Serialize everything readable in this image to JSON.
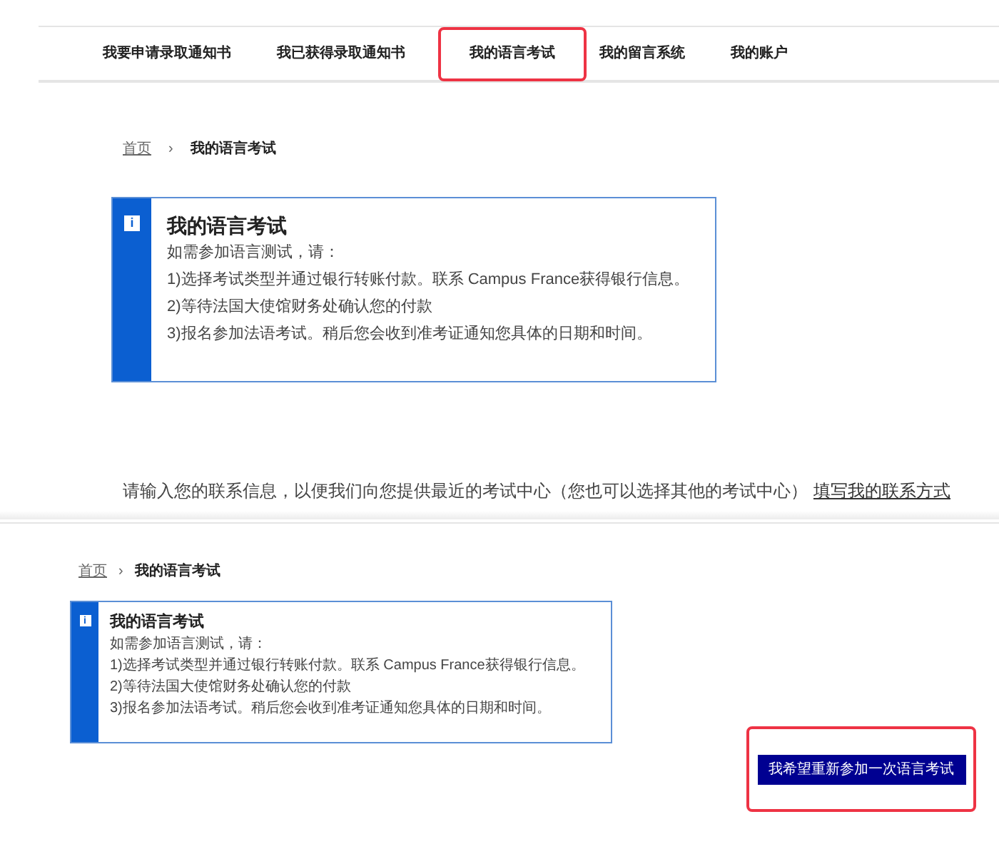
{
  "top_view": {
    "nav": [
      {
        "label": "我要申请录取通知书",
        "highlighted": false
      },
      {
        "label": "我已获得录取通知书",
        "highlighted": false
      },
      {
        "label": "我的语言考试",
        "highlighted": true
      },
      {
        "label": "我的留言系统",
        "highlighted": false
      },
      {
        "label": "我的账户",
        "highlighted": false
      }
    ],
    "breadcrumb": {
      "home": "首页",
      "separator": "›",
      "current": "我的语言考试"
    },
    "notice": {
      "icon": "i",
      "title": "我的语言考试",
      "lines": [
        "如需参加语言测试，请：",
        "1)选择考试类型并通过银行转账付款。联系 Campus France获得银行信息。",
        "2)等待法国大使馆财务处确认您的付款",
        "3)报名参加法语考试。稍后您会收到准考证通知您具体的日期和时间。"
      ]
    },
    "contact_text": "请输入您的联系信息，以便我们向您提供最近的考试中心（您也可以选择其他的考试中心）",
    "contact_link": "填写我的联系方式"
  },
  "bottom_view": {
    "breadcrumb": {
      "home": "首页",
      "separator": "›",
      "current": "我的语言考试"
    },
    "notice": {
      "icon": "i",
      "title": "我的语言考试",
      "lines": [
        "如需参加语言测试，请：",
        "1)选择考试类型并通过银行转账付款。联系 Campus France获得银行信息。",
        "2)等待法国大使馆财务处确认您的付款",
        "3)报名参加法语考试。稍后您会收到准考证通知您具体的日期和时间。"
      ]
    },
    "button": {
      "label": "我希望重新参加一次语言考试",
      "highlighted": true
    }
  }
}
